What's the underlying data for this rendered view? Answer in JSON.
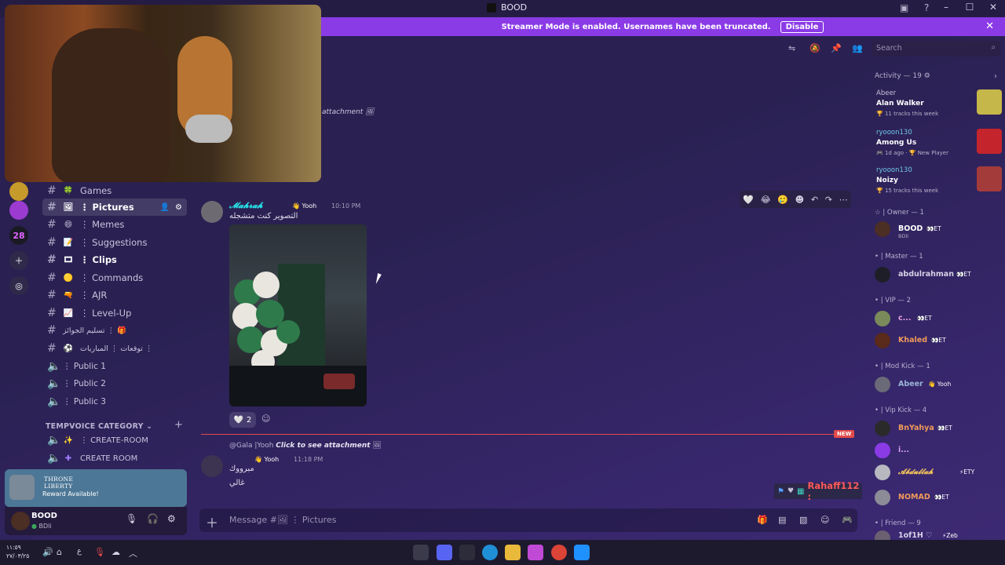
{
  "window": {
    "title": "BOOD"
  },
  "banner": {
    "text": "Streamer Mode is enabled. Usernames have been truncated.",
    "disable_label": "Disable"
  },
  "servers": {
    "badge_28": "28"
  },
  "channels": [
    {
      "label": "Games",
      "emoji": "🍀"
    },
    {
      "label": "⋮ Pictures",
      "emoji": "🖼"
    },
    {
      "label": "⋮ Memes",
      "emoji": "😄"
    },
    {
      "label": "⋮ Suggestions",
      "emoji": "📝"
    },
    {
      "label": "⋮ Clips",
      "emoji": "🎞"
    },
    {
      "label": "⋮ Commands",
      "emoji": "🟡"
    },
    {
      "label": "⋮ AJR",
      "emoji": "🔫"
    },
    {
      "label": "⋮ Level-Up",
      "emoji": "📈"
    },
    {
      "label": "تسليم الجوائز ⋮ 🎁",
      "emoji": ""
    },
    {
      "label": "توقعات ⋮ المباريات ⋮",
      "emoji": "⚽"
    },
    {
      "label": "⋮ Public 1",
      "emoji": ""
    },
    {
      "label": "⋮ Public 2",
      "emoji": ""
    },
    {
      "label": "⋮ Public 3",
      "emoji": ""
    }
  ],
  "tempvoice": {
    "category": "TEMPVOICE CATEGORY",
    "items": [
      {
        "label": "⋮ CREATE-ROOM",
        "emoji": "✨"
      },
      {
        "label": "CREATE ROOM",
        "emoji": "✚"
      }
    ]
  },
  "reward": {
    "brand_line1": "THRONE",
    "brand_line2": "LIBERTY",
    "text": "Reward Available!"
  },
  "user": {
    "name": "BOOD",
    "status": "BDli"
  },
  "search": {
    "placeholder": "Search"
  },
  "chat": {
    "partial_attachment": "attachment",
    "msg1": {
      "author": "𝓜𝓪𝓱𝓻𝓪𝓱",
      "tag": "👋 Yooh",
      "time": "10:10 PM",
      "text": "التصوير كنت متشجله"
    },
    "reaction": {
      "emoji": "🤍",
      "count": "2"
    },
    "new_label": "NEW",
    "msg2": {
      "reply_author": "@Gala |Yooh",
      "reply_text": "Click to see attachment",
      "tag": "👋 Yooh",
      "time": "11:18 PM",
      "line1": "مبرووك",
      "line2": "غالي"
    },
    "composer_placeholder": "Message #🖼 ⋮ Pictures"
  },
  "members": {
    "activity_head": "Activity — 19 ⚙",
    "activities": [
      {
        "who": "Abeer",
        "what": "Alan Walker",
        "sub": "🏆 11 tracks this week",
        "color": "#c6b74a"
      },
      {
        "who": "ryooon130",
        "what": "Among Us",
        "sub": "🎮 1d ago · 🏆 New Player",
        "color": "#c4242c"
      },
      {
        "who": "ryooon130",
        "what": "Noizy",
        "sub": "🏆 15 tracks this week",
        "color": "#a33b3b"
      }
    ],
    "roles": [
      {
        "label": "☆ | Owner — 1"
      },
      {
        "label": "• | Master — 1"
      },
      {
        "label": "• | VIP — 2"
      },
      {
        "label": "• | Mod Kick — 1"
      },
      {
        "label": "• | Vip Kick — 4"
      },
      {
        "label": "• | Friend — 9"
      }
    ],
    "people": [
      {
        "name": "BOOD",
        "tag": "👀ET",
        "sub": "BDli",
        "color": "#ffffff"
      },
      {
        "name": "abdulrahman",
        "tag": "👀ET",
        "sub": "",
        "color": "#d6d2e6"
      },
      {
        "name": "c...",
        "tag": "👀ET",
        "sub": "",
        "color": "#e8a3e4"
      },
      {
        "name": "Khaled",
        "tag": "👀ET",
        "sub": "",
        "color": "#f09a5a"
      },
      {
        "name": "Abeer",
        "tag": "👋 Yooh",
        "sub": "",
        "color": "#9ab3d6"
      },
      {
        "name": "BnYahya",
        "tag": "👀ET",
        "sub": "",
        "color": "#f09a5a"
      },
      {
        "name": "i...",
        "tag": "",
        "sub": "",
        "color": "#d6a0e8"
      },
      {
        "name": "𝓐𝓫𝓭𝓾𝓵𝓵𝓪𝓱",
        "tag": "⚡ETY",
        "sub": "",
        "color": "#f0c25a"
      },
      {
        "name": "NOMAD",
        "tag": "👀ET",
        "sub": "",
        "color": "#f09a5a"
      },
      {
        "name": "1of1H ♡",
        "tag": "⚡Zeb",
        "sub": "",
        "color": "#d6d2e6"
      }
    ]
  },
  "overlay": {
    "name": "Rahaff112 :"
  },
  "taskbar": {
    "time": "١١:٥٩",
    "date": "٢٧/٠٣/٢٥",
    "lang": "ع"
  }
}
